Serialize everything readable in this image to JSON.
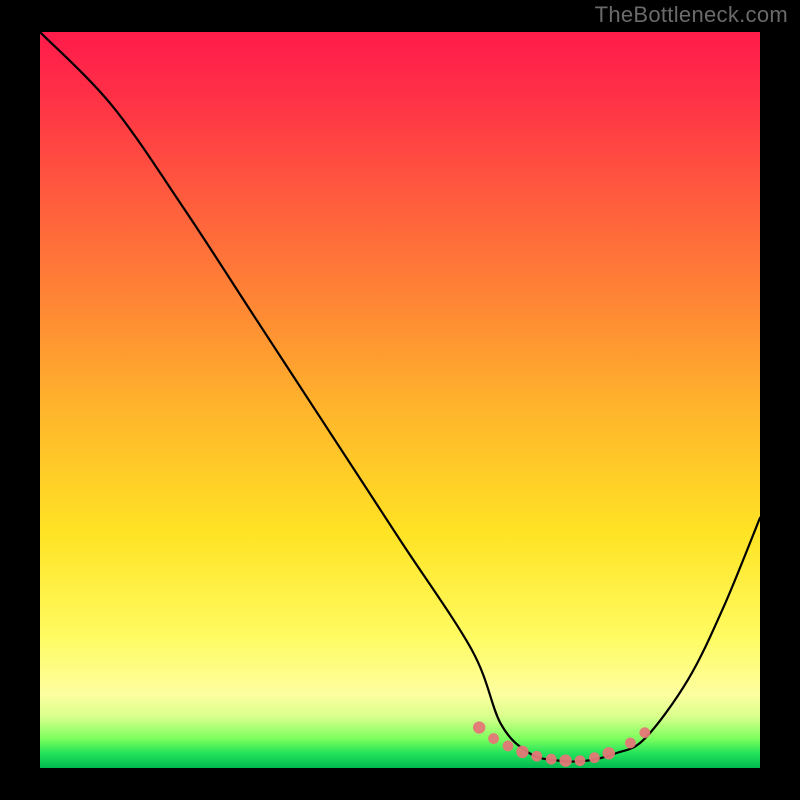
{
  "watermark": "TheBottleneck.com",
  "chart_data": {
    "type": "line",
    "title": "",
    "xlabel": "",
    "ylabel": "",
    "xlim": [
      0,
      100
    ],
    "ylim": [
      0,
      100
    ],
    "grid": false,
    "legend": false,
    "series": [
      {
        "name": "bottleneck-curve",
        "x": [
          0,
          10,
          20,
          30,
          40,
          50,
          60,
          64,
          68,
          72,
          76,
          80,
          84,
          90,
          95,
          100
        ],
        "values": [
          100,
          90,
          76,
          61,
          46,
          31,
          16,
          6,
          2,
          1,
          1,
          2,
          4,
          12,
          22,
          34
        ]
      }
    ],
    "markers": {
      "name": "highlighted-range",
      "color": "#e47777",
      "points": [
        {
          "x": 61,
          "y": 5.5
        },
        {
          "x": 63,
          "y": 4.0
        },
        {
          "x": 65,
          "y": 3.0
        },
        {
          "x": 67,
          "y": 2.2
        },
        {
          "x": 69,
          "y": 1.6
        },
        {
          "x": 71,
          "y": 1.2
        },
        {
          "x": 73,
          "y": 1.0
        },
        {
          "x": 75,
          "y": 1.0
        },
        {
          "x": 77,
          "y": 1.4
        },
        {
          "x": 79,
          "y": 2.0
        },
        {
          "x": 82,
          "y": 3.4
        },
        {
          "x": 84,
          "y": 4.8
        }
      ]
    },
    "background_gradient": {
      "type": "vertical",
      "stops": [
        {
          "pos": 0.0,
          "color": "#ff1b4a"
        },
        {
          "pos": 0.22,
          "color": "#ff5a3e"
        },
        {
          "pos": 0.52,
          "color": "#ffb72b"
        },
        {
          "pos": 0.82,
          "color": "#fffb60"
        },
        {
          "pos": 0.96,
          "color": "#7dff5e"
        },
        {
          "pos": 1.0,
          "color": "#00b850"
        }
      ]
    }
  }
}
